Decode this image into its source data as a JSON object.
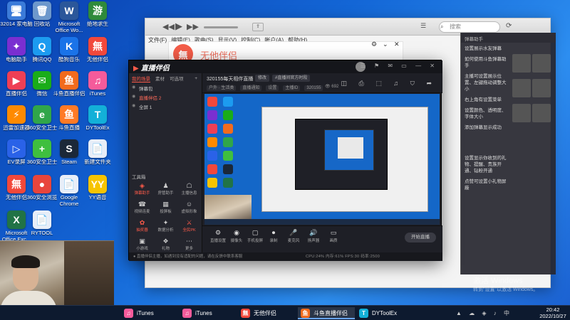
{
  "desktop": {
    "icons": [
      {
        "label": "32014 家电脑",
        "glyph": "🖥",
        "color": "#3b7bd9"
      },
      {
        "label": "回收站",
        "glyph": "🗑",
        "color": "#6d98cc"
      },
      {
        "label": "Microsoft Office Wo...",
        "glyph": "W",
        "color": "#2b579a"
      },
      {
        "label": "绝地求生",
        "glyph": "游",
        "color": "#2f8a3b"
      },
      {
        "label": "电脑助手",
        "glyph": "✦",
        "color": "#7a2fd1"
      },
      {
        "label": "腾讯QQ",
        "glyph": "Q",
        "color": "#1c9bf0"
      },
      {
        "label": "酷狗音乐",
        "glyph": "K",
        "color": "#1a73e8"
      },
      {
        "label": "无他伴侣",
        "glyph": "無",
        "color": "#f2483b"
      },
      {
        "label": "直播伴侣",
        "glyph": "▶",
        "color": "#ee3f55"
      },
      {
        "label": "微信",
        "glyph": "✉",
        "color": "#1aad19"
      },
      {
        "label": "斗鱼直播伴侣",
        "glyph": "鱼",
        "color": "#f26b1d"
      },
      {
        "label": "iTunes",
        "glyph": "♫",
        "color": "#f45b9b"
      },
      {
        "label": "迅雷加速器",
        "glyph": "⚡",
        "color": "#ff8a00"
      },
      {
        "label": "360安全卫士",
        "glyph": "e",
        "color": "#30a64a"
      },
      {
        "label": "斗鱼直播",
        "glyph": "鱼",
        "color": "#ff7a25"
      },
      {
        "label": "DYToolEx",
        "glyph": "T",
        "color": "#13b0d8"
      },
      {
        "label": "EV录屏",
        "glyph": "▷",
        "color": "#2a62e8"
      },
      {
        "label": "360安全卫士",
        "glyph": "+",
        "color": "#3fbf3f"
      },
      {
        "label": "Steam",
        "glyph": "S",
        "color": "#1b2838"
      },
      {
        "label": "新建文件夹",
        "glyph": "📄",
        "color": "#e8eef8"
      },
      {
        "label": "无他伴侣",
        "glyph": "無",
        "color": "#f2483b"
      },
      {
        "label": "360安全浏览",
        "glyph": "●",
        "color": "#e8453c"
      },
      {
        "label": "Google Chrome",
        "glyph": "📄",
        "color": "#e8eef8"
      },
      {
        "label": "YY语音",
        "glyph": "YY",
        "color": "#f7c400"
      },
      {
        "label": "Microsoft Office Exc...",
        "glyph": "X",
        "color": "#217346"
      },
      {
        "label": "RYTOOL",
        "glyph": "📄",
        "color": "#e8eef8"
      }
    ]
  },
  "itunes": {
    "menu": [
      "文件(F)",
      "编辑(E)",
      "歌曲(S)",
      "显示(V)",
      "控制(C)",
      "帐户(A)",
      "帮助(H)"
    ],
    "search_placeholder": "搜索",
    "apple_glyph": ""
  },
  "wushu": {
    "logo_glyph": "無",
    "title": "无他伴侣"
  },
  "side_panel": {
    "header": "弹幕助手",
    "paragraphs": [
      "设置展示水友弹幕",
      "如何使用斗鱼弹幕助手",
      "主播可设置展示位置、左键拖动调整大小",
      "右上角有设置菜单",
      "设置颜色、透明度、字体大小",
      "添加弹幕显示成功",
      "设置显示你收到的礼物、提醒、贵族开通、钻粉开通",
      "点赞可设置小礼物屏蔽"
    ]
  },
  "watermark": {
    "line1": "激活 Windows",
    "line2": "转到\"设置\"以激活 Windows。"
  },
  "zb": {
    "app_name": "直播伴侣",
    "tabs": [
      "我的场景",
      "素材",
      "可选项"
    ],
    "scenes": [
      "弹幕包",
      "直播伴侣 2",
      "全屏 1"
    ],
    "toolbox_title": "工具箱",
    "tools": [
      {
        "label": "弹幕助手",
        "glyph": "◈",
        "hot": true
      },
      {
        "label": "房管助手",
        "glyph": "♟",
        "hot": false
      },
      {
        "label": "主播信息",
        "glyph": "☖",
        "hot": false
      },
      {
        "label": "视频连麦",
        "glyph": "☎",
        "hot": false
      },
      {
        "label": "投屏板",
        "glyph": "▦",
        "hot": false
      },
      {
        "label": "虚拟形象",
        "glyph": "☺",
        "hot": false
      },
      {
        "label": "抽奖器",
        "glyph": "✿",
        "hot": true
      },
      {
        "label": "数据分析",
        "glyph": "✦",
        "hot": false
      },
      {
        "label": "全民PK",
        "glyph": "⚔",
        "hot": true
      },
      {
        "label": "小游戏",
        "glyph": "▣",
        "hot": false
      },
      {
        "label": "礼物",
        "glyph": "❖",
        "hot": false
      },
      {
        "label": "更多",
        "glyph": "⋯",
        "hot": false
      }
    ],
    "room_title": "320155每天相伴直播",
    "pills": [
      "修改",
      "#直播间官方时段"
    ],
    "row2": [
      "户外 · 生活类",
      "直播通知",
      "设置",
      "主播ID",
      "320155"
    ],
    "viewer_count": "692",
    "controls": [
      {
        "label": "直播设置",
        "glyph": "⚙"
      },
      {
        "label": "摄像头",
        "glyph": "◉"
      },
      {
        "label": "手机投屏",
        "glyph": "▢"
      },
      {
        "label": "录制",
        "glyph": "⏺"
      },
      {
        "label": "麦克风",
        "glyph": "🎤"
      },
      {
        "label": "扬声器",
        "glyph": "🔊"
      },
      {
        "label": "画质",
        "glyph": "▭"
      }
    ],
    "start_label": "开始直播",
    "status_text": "● 直播伴侣主播，如遇到没有适配的问题，请在反馈中联系客服",
    "status_metrics": "CPU:24%  内存:61%  FPS:30  码率:2500"
  },
  "taskbar": {
    "tasks": [
      {
        "label": "iTunes",
        "glyph": "♫",
        "color": "#f45b9b",
        "active": false
      },
      {
        "label": "iTunes",
        "glyph": "♫",
        "color": "#f45b9b",
        "active": false
      },
      {
        "label": "无他伴侣",
        "glyph": "無",
        "color": "#f2483b",
        "active": false
      },
      {
        "label": "斗鱼直播伴侣",
        "glyph": "鱼",
        "color": "#f26b1d",
        "active": true
      },
      {
        "label": "DYToolEx",
        "glyph": "T",
        "color": "#13b0d8",
        "active": false
      }
    ],
    "tray_glyphs": "▲ ☁ ◈ ♪ 中",
    "time": "20:42",
    "date": "2022/10/27"
  }
}
